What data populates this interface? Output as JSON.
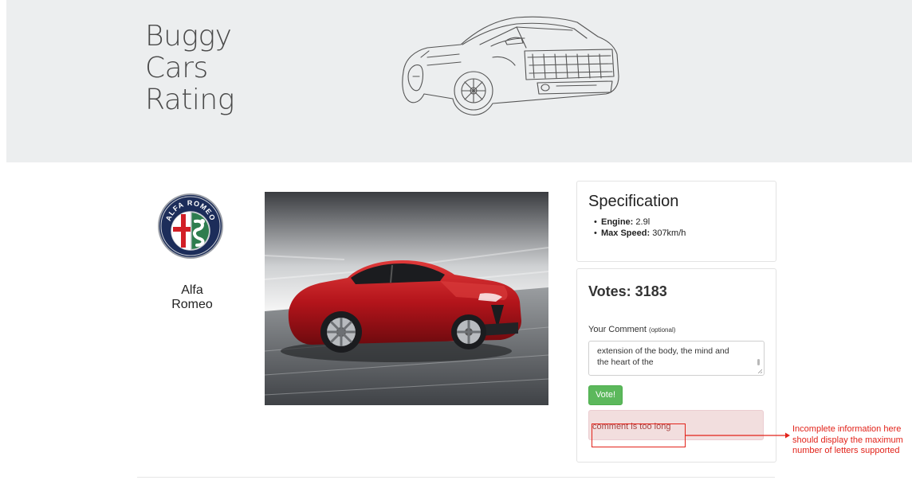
{
  "header": {
    "brand_lines": [
      "Buggy",
      "Cars",
      "Rating"
    ]
  },
  "model": {
    "make_name": "Alfa\nRomeo",
    "make_line1": "Alfa",
    "make_line2": "Romeo",
    "logo_text": "ALFA ROMEO"
  },
  "specification": {
    "title": "Specification",
    "items": [
      {
        "label": "Engine:",
        "value": "2.9l"
      },
      {
        "label": "Max Speed:",
        "value": "307km/h"
      }
    ]
  },
  "voting": {
    "votes_title": "Votes: 3183",
    "comment_label": "Your Comment",
    "comment_optional": "(optional)",
    "comment_value": "extension of the body, the mind and\nthe heart of the",
    "vote_button": "Vote!",
    "error_message": "comment is too long"
  },
  "annotation": {
    "lines": [
      "Incomplete information here",
      "should display the maximum",
      "number of letters supported"
    ],
    "color": "#e2231a"
  },
  "colors": {
    "hero_bg": "#eceeef",
    "vote_button": "#5cb85c",
    "alert_bg": "#f2dede",
    "alert_text": "#a94442"
  }
}
